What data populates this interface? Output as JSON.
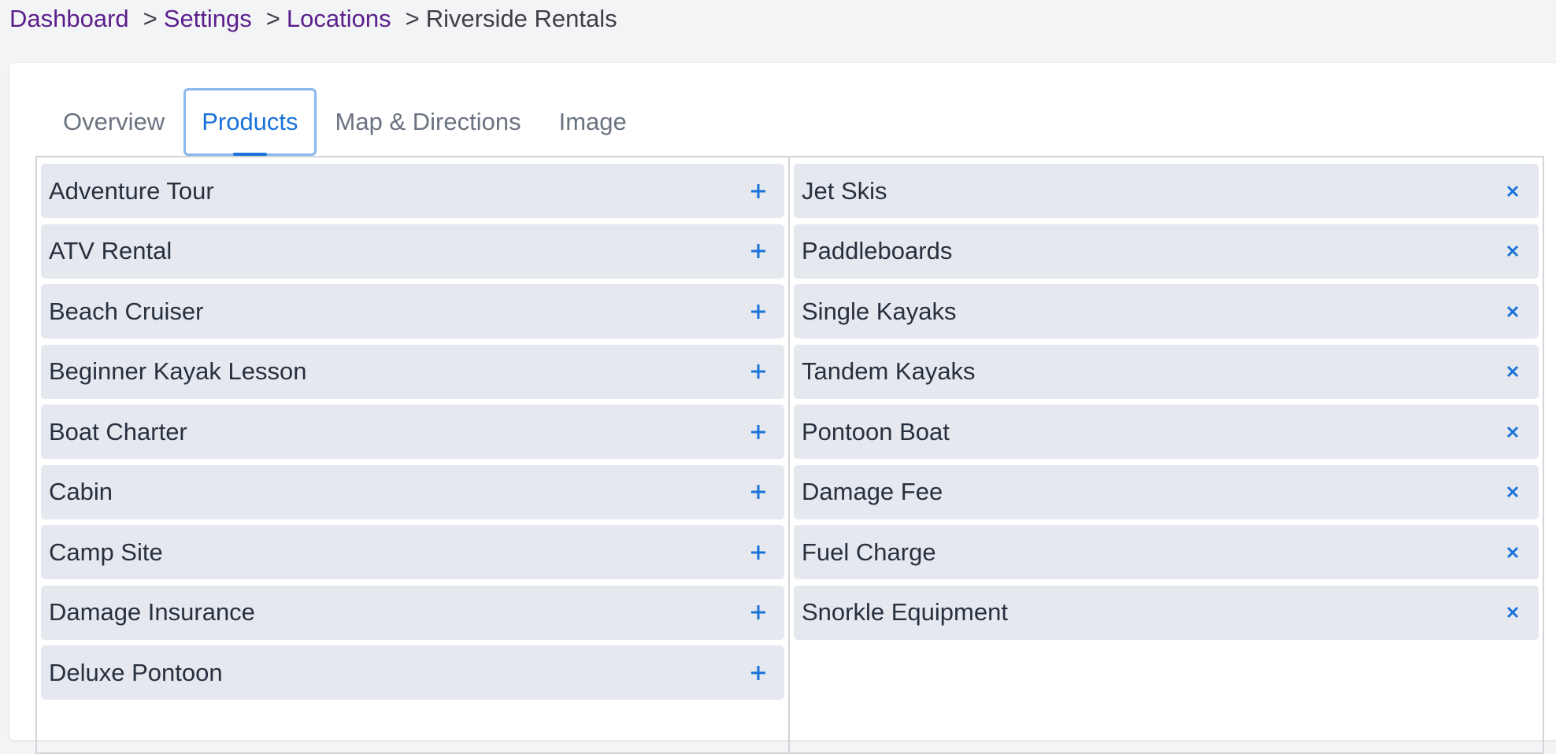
{
  "breadcrumb": {
    "items": [
      {
        "label": "Dashboard",
        "link": true
      },
      {
        "label": "Settings",
        "link": true
      },
      {
        "label": "Locations",
        "link": true
      },
      {
        "label": "Riverside Rentals",
        "link": false
      }
    ],
    "separator": ">"
  },
  "tabs": [
    {
      "label": "Overview",
      "active": false
    },
    {
      "label": "Products",
      "active": true
    },
    {
      "label": "Map & Directions",
      "active": false
    },
    {
      "label": "Image",
      "active": false
    }
  ],
  "available_products": [
    {
      "label": "Adventure Tour",
      "icon": "plus-icon"
    },
    {
      "label": "ATV Rental",
      "icon": "plus-icon"
    },
    {
      "label": "Beach Cruiser",
      "icon": "plus-icon"
    },
    {
      "label": "Beginner Kayak Lesson",
      "icon": "plus-icon"
    },
    {
      "label": "Boat Charter",
      "icon": "plus-icon"
    },
    {
      "label": "Cabin",
      "icon": "plus-icon"
    },
    {
      "label": "Camp Site",
      "icon": "plus-icon"
    },
    {
      "label": "Damage Insurance",
      "icon": "plus-icon"
    },
    {
      "label": "Deluxe Pontoon",
      "icon": "plus-icon"
    }
  ],
  "assigned_products": [
    {
      "label": "Jet Skis",
      "icon": "close-icon"
    },
    {
      "label": "Paddleboards",
      "icon": "close-icon"
    },
    {
      "label": "Single Kayaks",
      "icon": "close-icon"
    },
    {
      "label": "Tandem Kayaks",
      "icon": "close-icon"
    },
    {
      "label": "Pontoon Boat",
      "icon": "close-icon"
    },
    {
      "label": "Damage Fee",
      "icon": "close-icon"
    },
    {
      "label": "Fuel Charge",
      "icon": "close-icon"
    },
    {
      "label": "Snorkle Equipment",
      "icon": "close-icon"
    }
  ],
  "colors": {
    "accent": "#1a73d9",
    "link": "#5b1f8c",
    "row_bg": "#e5e8ee",
    "page_bg": "#f3f4f6"
  }
}
